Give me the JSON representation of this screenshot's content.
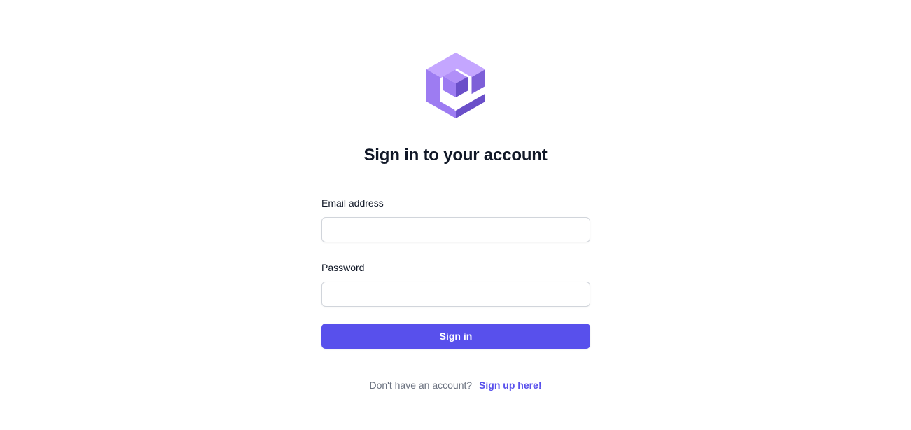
{
  "brand": {
    "logo_icon": "cube-logo-icon",
    "colors": {
      "logo_light": "#c4a6ff",
      "logo_mid": "#9d7cf2",
      "logo_dark": "#6a4fc9",
      "accent": "#5850ec"
    }
  },
  "signin": {
    "title": "Sign in to your account",
    "email": {
      "label": "Email address",
      "value": "",
      "placeholder": ""
    },
    "password": {
      "label": "Password",
      "value": "",
      "placeholder": ""
    },
    "submit_label": "Sign in"
  },
  "footer": {
    "prompt_text": "Don't have an account?",
    "signup_link": "Sign up here!"
  }
}
